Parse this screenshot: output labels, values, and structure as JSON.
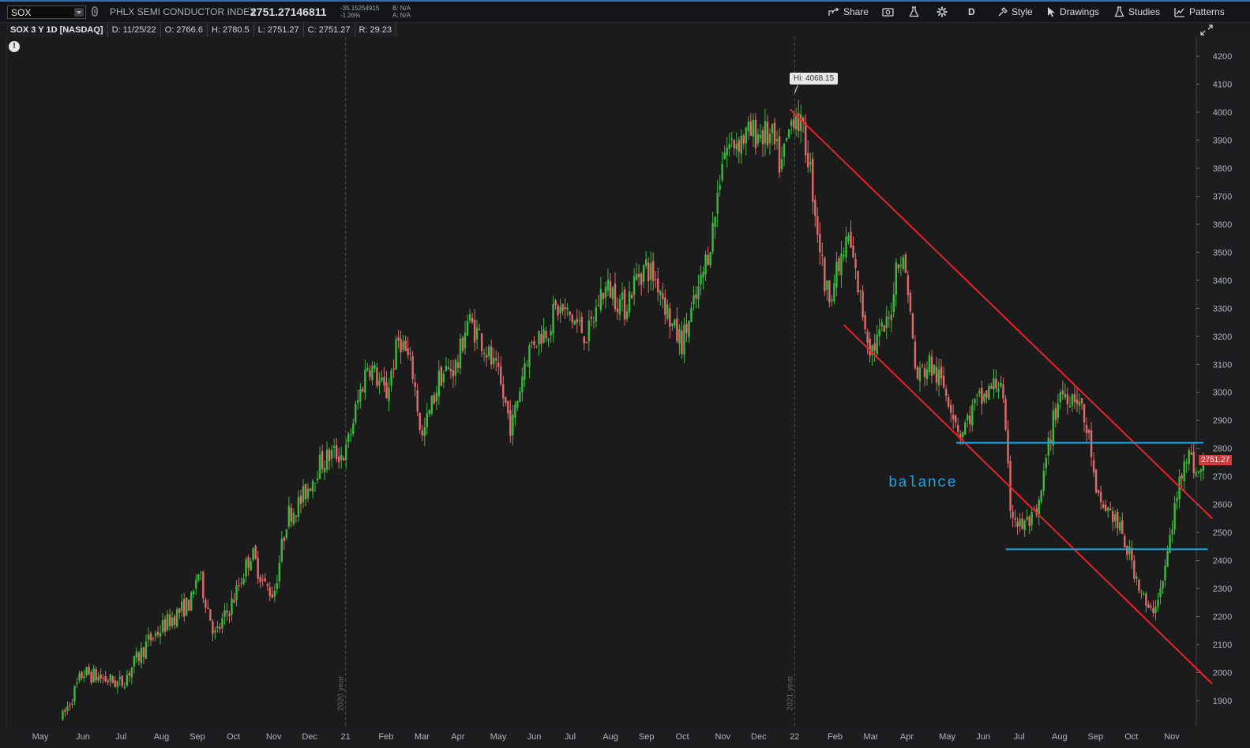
{
  "header": {
    "symbol": "SOX",
    "description": "PHLX SEMI CONDUCTOR INDEX",
    "last_price": "2751.27146811",
    "net_change": "-35.15254915",
    "pct_change": "-1.26%",
    "bid": "B: N/A",
    "ask": "A: N/A",
    "share_label": "Share",
    "aggregation": "D",
    "style_label": "Style",
    "drawings_label": "Drawings",
    "studies_label": "Studies",
    "patterns_label": "Patterns"
  },
  "ohlc": {
    "name": "SOX 3 Y 1D [NASDAQ]",
    "date": "D: 11/25/22",
    "open": "O: 2766.6",
    "high": "H: 2780.5",
    "low": "L: 2751.27",
    "close": "C: 2751.27",
    "range": "R: 29.23"
  },
  "annotations": {
    "hi_label": "Hi: 4068.15",
    "price_tag": "2751.27",
    "balance_text": "balance",
    "alert_icon": "!"
  },
  "colors": {
    "up": "#3cb83c",
    "down": "#e06b6b",
    "trendline": "#e8212a",
    "level_line": "#1aa7e6",
    "background": "#1b1b1b"
  },
  "chart_data": {
    "type": "candlestick",
    "title": "",
    "y_ticks": [
      4200,
      4100,
      4000,
      3900,
      3800,
      3700,
      3600,
      3500,
      3400,
      3300,
      3200,
      3100,
      3000,
      2900,
      2800,
      2700,
      2600,
      2500,
      2400,
      2300,
      2200,
      2100,
      2000,
      1900
    ],
    "ylim": [
      1830,
      4290
    ],
    "x_ticks": [
      "May",
      "Jun",
      "Jul",
      "Aug",
      "Sep",
      "Oct",
      "Nov",
      "Dec",
      "21",
      "Feb",
      "Mar",
      "Apr",
      "May",
      "Jun",
      "Jul",
      "Aug",
      "Sep",
      "Oct",
      "Nov",
      "Dec",
      "22",
      "Feb",
      "Mar",
      "Apr",
      "May",
      "Jun",
      "Jul",
      "Aug",
      "Sep",
      "Oct",
      "Nov"
    ],
    "x_tick_t": [
      -0.5,
      0.45,
      1.3,
      2.2,
      3.0,
      3.8,
      4.7,
      5.5,
      6.3,
      7.2,
      8.0,
      8.8,
      9.7,
      10.5,
      11.3,
      12.2,
      13.0,
      13.8,
      14.7,
      15.5,
      16.3,
      17.2,
      18.0,
      18.8,
      19.7,
      20.5,
      21.3,
      22.2,
      23.0,
      23.8,
      24.7
    ],
    "year_markers": [
      {
        "label": "2020 year",
        "t": 6.3
      },
      {
        "label": "2021 year",
        "t": 16.3
      }
    ],
    "high": 4068.15,
    "high_t": 16.3,
    "last": 2751.27,
    "waypoints": [
      [
        0,
        1840
      ],
      [
        0.45,
        2000
      ],
      [
        1.3,
        1960
      ],
      [
        1.9,
        2110
      ],
      [
        2.4,
        2190
      ],
      [
        2.9,
        2260
      ],
      [
        3.0,
        2370
      ],
      [
        3.4,
        2130
      ],
      [
        3.8,
        2260
      ],
      [
        4.2,
        2430
      ],
      [
        4.5,
        2310
      ],
      [
        4.7,
        2280
      ],
      [
        5.0,
        2560
      ],
      [
        5.3,
        2610
      ],
      [
        5.7,
        2740
      ],
      [
        6.0,
        2780
      ],
      [
        6.3,
        2780
      ],
      [
        6.5,
        2920
      ],
      [
        6.8,
        3110
      ],
      [
        7.2,
        2990
      ],
      [
        7.5,
        3200
      ],
      [
        7.8,
        3070
      ],
      [
        8.0,
        2830
      ],
      [
        8.4,
        3060
      ],
      [
        8.8,
        3100
      ],
      [
        9.0,
        3260
      ],
      [
        9.3,
        3200
      ],
      [
        9.7,
        3050
      ],
      [
        10.0,
        2870
      ],
      [
        10.3,
        3120
      ],
      [
        10.5,
        3190
      ],
      [
        10.8,
        3230
      ],
      [
        11.0,
        3300
      ],
      [
        11.3,
        3270
      ],
      [
        11.7,
        3200
      ],
      [
        12.0,
        3360
      ],
      [
        12.2,
        3370
      ],
      [
        12.5,
        3300
      ],
      [
        12.8,
        3420
      ],
      [
        13.0,
        3450
      ],
      [
        13.3,
        3380
      ],
      [
        13.6,
        3220
      ],
      [
        13.8,
        3180
      ],
      [
        14.2,
        3380
      ],
      [
        14.5,
        3600
      ],
      [
        14.7,
        3860
      ],
      [
        15.0,
        3900
      ],
      [
        15.5,
        3930
      ],
      [
        15.8,
        3900
      ],
      [
        16.0,
        3800
      ],
      [
        16.3,
        4020
      ],
      [
        16.6,
        3850
      ],
      [
        17.0,
        3350
      ],
      [
        17.2,
        3400
      ],
      [
        17.5,
        3550
      ],
      [
        17.8,
        3300
      ],
      [
        18.0,
        3150
      ],
      [
        18.4,
        3250
      ],
      [
        18.6,
        3500
      ],
      [
        18.8,
        3420
      ],
      [
        19.0,
        3050
      ],
      [
        19.3,
        3100
      ],
      [
        19.7,
        3000
      ],
      [
        20.0,
        2850
      ],
      [
        20.3,
        2950
      ],
      [
        20.5,
        2980
      ],
      [
        20.9,
        3050
      ],
      [
        21.1,
        2600
      ],
      [
        21.3,
        2520
      ],
      [
        21.7,
        2550
      ],
      [
        22.0,
        2850
      ],
      [
        22.2,
        3000
      ],
      [
        22.6,
        2990
      ],
      [
        22.9,
        2800
      ],
      [
        23.0,
        2620
      ],
      [
        23.4,
        2560
      ],
      [
        23.8,
        2400
      ],
      [
        24.2,
        2200
      ],
      [
        24.5,
        2320
      ],
      [
        24.7,
        2520
      ],
      [
        25.0,
        2800
      ],
      [
        25.3,
        2700
      ],
      [
        25.4,
        2751
      ]
    ],
    "series": []
  },
  "drawings": {
    "channel_upper": [
      [
        16.2,
        4010
      ],
      [
        25.6,
        2550
      ]
    ],
    "channel_lower": [
      [
        17.4,
        3240
      ],
      [
        25.6,
        1960
      ]
    ],
    "resistance": [
      [
        19.9,
        2820
      ],
      [
        25.4,
        2820
      ]
    ],
    "support": [
      [
        21.0,
        2440
      ],
      [
        25.5,
        2440
      ]
    ]
  }
}
